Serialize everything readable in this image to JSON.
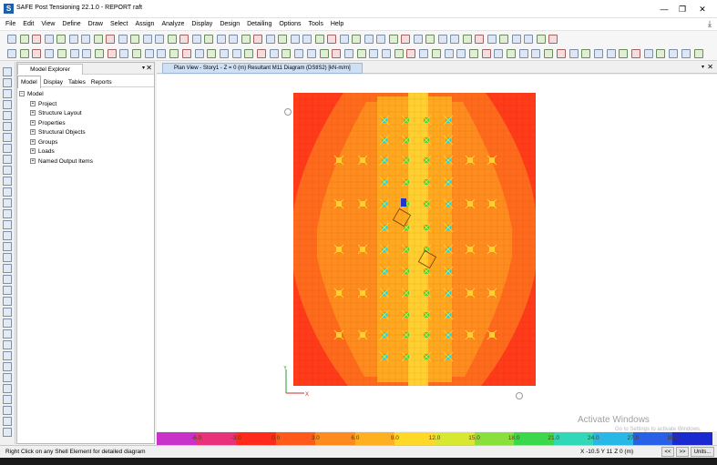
{
  "app": {
    "title": "SAFE Post Tensioning 22.1.0 - REPORT raft",
    "logo_letter": "S",
    "window_buttons": [
      "—",
      "❐",
      "✕"
    ]
  },
  "menu": [
    "File",
    "Edit",
    "View",
    "Define",
    "Draw",
    "Select",
    "Assign",
    "Analyze",
    "Display",
    "Design",
    "Detailing",
    "Options",
    "Tools",
    "Help"
  ],
  "explorer": {
    "title": "Model Explorer",
    "tabs": [
      "Model",
      "Display",
      "Tables",
      "Reports"
    ],
    "active_tab": "Model",
    "root": "Model",
    "items": [
      "Project",
      "Structure Layout",
      "Properties",
      "Structural Objects",
      "Groups",
      "Loads",
      "Named Output Items"
    ]
  },
  "view": {
    "tab_title": "Plan View - Story1 - Z = 0 (m)    Resultant M11 Diagram    (DStlS2)  [kN-m/m]"
  },
  "plot": {
    "axis_x_label": "X",
    "axis_y_label": "Y",
    "colors": {
      "outer": "#ff3b1a",
      "band": "#ff6a1c",
      "inner": "#ff8c1e",
      "core": "#ffa820",
      "hot": "#ffd030",
      "peak_green": "#39d44a",
      "peak_cyan": "#22d0d8",
      "peak_blue": "#1a3ad8"
    }
  },
  "colorbar": {
    "labels": [
      "-6.0",
      "-3.0",
      "0.0",
      "3.0",
      "6.0",
      "9.0",
      "12.0",
      "15.0",
      "18.0",
      "21.0",
      "24.0",
      "27.0",
      "30.0"
    ],
    "colors": [
      "#c832c8",
      "#e8327a",
      "#ff2a1a",
      "#ff5a1c",
      "#ff8a1e",
      "#ffb020",
      "#ffd828",
      "#d8e830",
      "#8ae03a",
      "#3ad84a",
      "#30d8b8",
      "#28b8e8",
      "#2860e8",
      "#1a2ad0"
    ]
  },
  "watermark": {
    "line1": "Activate Windows",
    "line2": "Go to Settings to activate Windows."
  },
  "status": {
    "hint": "Right Click on any Shell Element for detailed diagram",
    "coords": "X -10.5  Y 11  Z 0 (m)",
    "prev": "<<",
    "next": ">>",
    "units": "Units..."
  }
}
